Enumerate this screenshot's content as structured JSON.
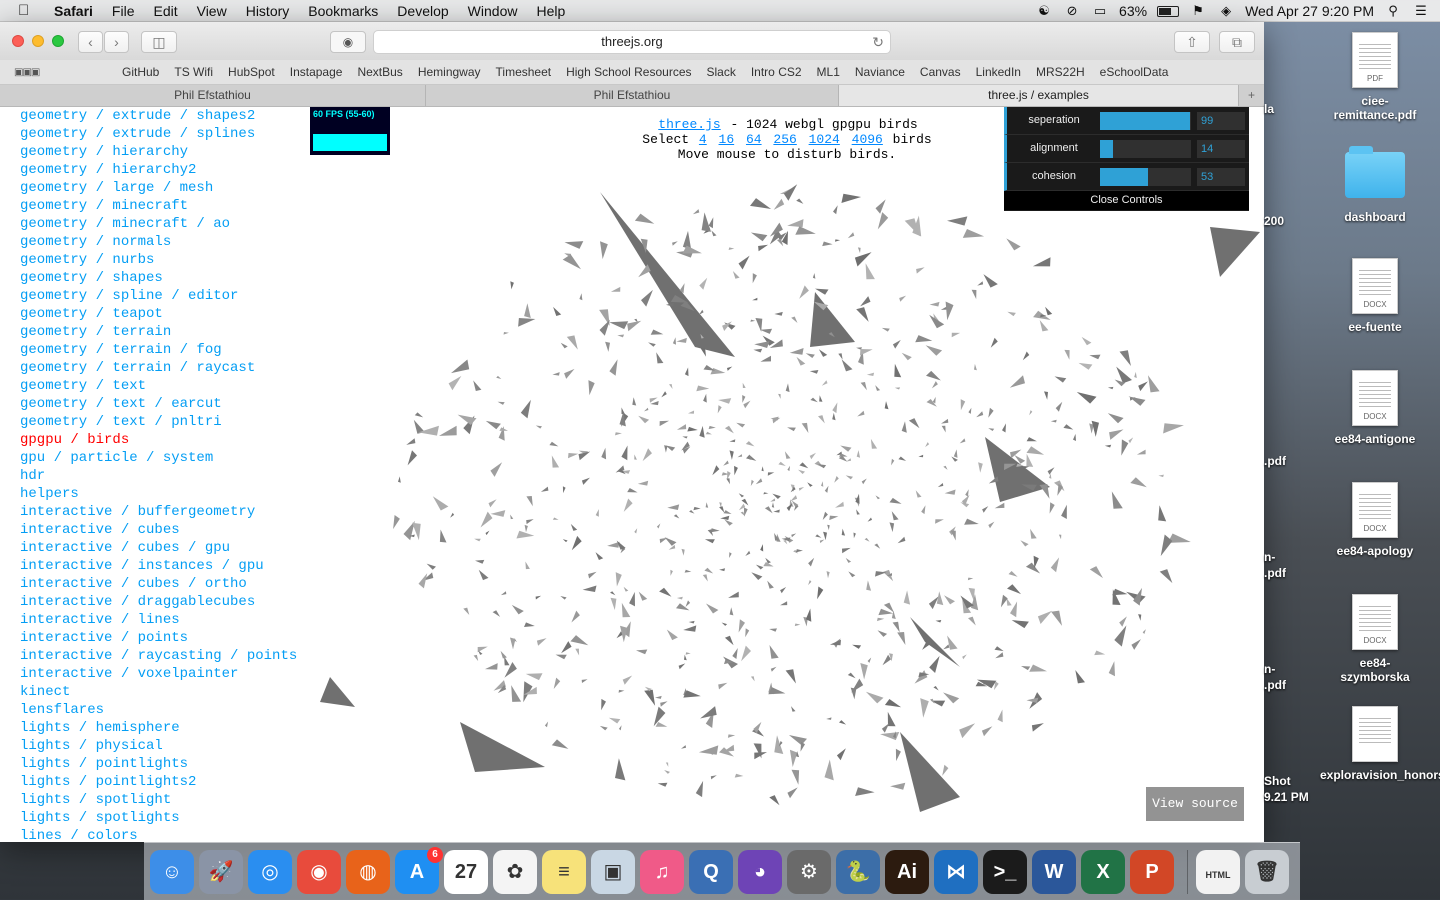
{
  "menubar": {
    "app_name": "Safari",
    "items": [
      "File",
      "Edit",
      "View",
      "History",
      "Bookmarks",
      "Develop",
      "Window",
      "Help"
    ],
    "battery": "63%",
    "datetime": "Wed Apr 27  9:20 PM"
  },
  "browser": {
    "address": "threejs.org",
    "bookmarks": [
      "GitHub",
      "TS Wifi",
      "HubSpot",
      "Instapage",
      "NextBus",
      "Hemingway",
      "Timesheet",
      "High School Resources",
      "Slack",
      "Intro CS2",
      "ML1",
      "Naviance",
      "Canvas",
      "LinkedIn",
      "MRS22H",
      "eSchoolData"
    ],
    "tabs": [
      "Phil Efstathiou",
      "Phil Efstathiou",
      "three.js / examples"
    ],
    "new_tab": "+"
  },
  "examples": [
    "geometry / extrude / shapes2",
    "geometry / extrude / splines",
    "geometry / hierarchy",
    "geometry / hierarchy2",
    "geometry / large / mesh",
    "geometry / minecraft",
    "geometry / minecraft / ao",
    "geometry / normals",
    "geometry / nurbs",
    "geometry / shapes",
    "geometry / spline / editor",
    "geometry / teapot",
    "geometry / terrain",
    "geometry / terrain / fog",
    "geometry / terrain / raycast",
    "geometry / text",
    "geometry / text / earcut",
    "geometry / text / pnltri",
    "gpgpu / birds",
    "gpu / particle / system",
    "hdr",
    "helpers",
    "interactive / buffergeometry",
    "interactive / cubes",
    "interactive / cubes / gpu",
    "interactive / instances / gpu",
    "interactive / cubes / ortho",
    "interactive / draggablecubes",
    "interactive / lines",
    "interactive / points",
    "interactive / raycasting / points",
    "interactive / voxelpainter",
    "kinect",
    "lensflares",
    "lights / hemisphere",
    "lights / physical",
    "lights / pointlights",
    "lights / pointlights2",
    "lights / spotlight",
    "lights / spotlights",
    "lines / colors"
  ],
  "selected_example": "gpgpu / birds",
  "demo": {
    "stats": "60 FPS (55-60)",
    "info_link": "three.js",
    "info_line1": " - 1024 webgl gpgpu birds",
    "select_label": "Select",
    "select_options": [
      "4",
      "16",
      "64",
      "256",
      "1024",
      "4096"
    ],
    "birds_label": "birds",
    "info_line3": "Move mouse to disturb birds.",
    "controls": [
      {
        "label": "seperation",
        "value": "99",
        "fraction": 0.99
      },
      {
        "label": "alignment",
        "value": "14",
        "fraction": 0.14
      },
      {
        "label": "cohesion",
        "value": "53",
        "fraction": 0.53
      }
    ],
    "close_controls": "Close Controls",
    "view_source": "View source"
  },
  "desktop": {
    "icons": [
      {
        "name": "ciee-remittance.pdf",
        "type": "PDF"
      },
      {
        "name": "dashboard",
        "type": "folder"
      },
      {
        "name": "ee-fuente",
        "type": "DOCX"
      },
      {
        "name": "ee84-antigone",
        "type": "DOCX"
      },
      {
        "name": "ee84-apology",
        "type": "DOCX"
      },
      {
        "name": "ee84-szymborska",
        "type": "DOCX"
      },
      {
        "name": "exploravision_honors.pdf",
        "type": "PDF"
      }
    ],
    "partial_labels": [
      "la",
      "200",
      ".pdf",
      "n-",
      ".pdf",
      "n-",
      ".pdf",
      "Shot",
      "9.21 PM"
    ]
  },
  "dock": {
    "apps": [
      {
        "name": "Finder",
        "color": "#3d8ee8",
        "glyph": "☺"
      },
      {
        "name": "Launchpad",
        "color": "#8a94a6",
        "glyph": "🚀"
      },
      {
        "name": "Safari",
        "color": "#2a8ef0",
        "glyph": "◎"
      },
      {
        "name": "Chrome",
        "color": "#e84b3c",
        "glyph": "◉"
      },
      {
        "name": "Firefox",
        "color": "#e8631a",
        "glyph": "◍"
      },
      {
        "name": "App Store",
        "color": "#1f8ff2",
        "glyph": "A",
        "badge": "6"
      },
      {
        "name": "Calendar",
        "color": "#ffffff",
        "glyph": "27"
      },
      {
        "name": "Photos",
        "color": "#f4f4f4",
        "glyph": "✿"
      },
      {
        "name": "Notes",
        "color": "#f7e27a",
        "glyph": "≡"
      },
      {
        "name": "Preview",
        "color": "#c9d7e4",
        "glyph": "▣"
      },
      {
        "name": "iTunes",
        "color": "#f05a88",
        "glyph": "♫"
      },
      {
        "name": "QuickTime",
        "color": "#3a6fb4",
        "glyph": "Q"
      },
      {
        "name": "GitHub",
        "color": "#6e44b6",
        "glyph": "◕"
      },
      {
        "name": "System Preferences",
        "color": "#6a6a6a",
        "glyph": "⚙"
      },
      {
        "name": "Python",
        "color": "#3c6ea8",
        "glyph": "🐍"
      },
      {
        "name": "Illustrator",
        "color": "#2c1b0f",
        "glyph": "Ai"
      },
      {
        "name": "Visual Studio Code",
        "color": "#1f6fc1",
        "glyph": "⋈"
      },
      {
        "name": "Terminal",
        "color": "#1b1b1b",
        "glyph": ">_"
      },
      {
        "name": "Word",
        "color": "#2b579a",
        "glyph": "W"
      },
      {
        "name": "Excel",
        "color": "#217346",
        "glyph": "X"
      },
      {
        "name": "PowerPoint",
        "color": "#d24726",
        "glyph": "P"
      }
    ],
    "right": [
      {
        "name": "HTML Document",
        "color": "#f2f2f2",
        "glyph": "HTML"
      },
      {
        "name": "Trash",
        "color": "#c8cdd2",
        "glyph": "🗑"
      }
    ]
  }
}
